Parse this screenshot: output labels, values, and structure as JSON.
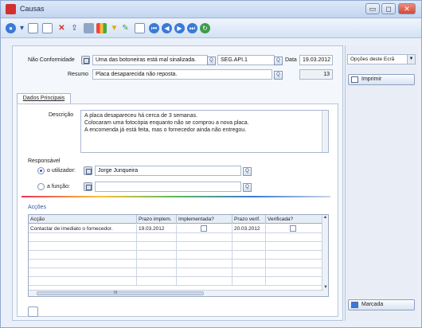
{
  "window": {
    "title": "Causas",
    "controls": {
      "minimize": "▭",
      "maximize": "◻",
      "close": "✕"
    }
  },
  "toolbar": {
    "icons": [
      "quick-access-icon",
      "new-icon",
      "copy-icon",
      "delete-icon",
      "export-icon",
      "list-icon",
      "chart-icon",
      "filter-icon",
      "edit-icon",
      "print-preview-icon",
      "nav-first-icon",
      "nav-prev-icon",
      "nav-next-icon",
      "nav-last-icon",
      "refresh-icon"
    ]
  },
  "form": {
    "nao_conformidade_label": "Não Conformidade",
    "nao_conformidade_value": "Uma das botoneiras está mal sinalizada.",
    "codigo_value": "SEG.API.1",
    "data_label": "Data",
    "data_value": "19.03.2012",
    "resumo_label": "Resumo",
    "resumo_value": "Placa desaparecida não reposta.",
    "resumo_number": "13"
  },
  "tabs": [
    {
      "label": "Dados Principais"
    }
  ],
  "descricao": {
    "label": "Descrição",
    "lines": [
      "A placa desapareceu há cerca de 3 semanas.",
      "Colocaram uma fotocópia enquanto não se comprou a nova placa.",
      "A encomenda já está feita, mas o fornecedor ainda não entregou."
    ]
  },
  "responsavel": {
    "label": "Responsável",
    "utilizador_label": "o utilizador:",
    "utilizador_value": "Jorge Junqueira",
    "funcao_label": "a função:",
    "funcao_value": ""
  },
  "accoes": {
    "label": "Acções",
    "columns": [
      "Acção",
      "Prazo implem.",
      "Implementada?",
      "Prazo verif.",
      "Verificada?"
    ],
    "rows": [
      {
        "accao": "Contactar de imediato o fornecedor.",
        "prazo_implem": "19.03.2012",
        "implementada": false,
        "prazo_verif": "20.03.2012",
        "verificada": false
      }
    ],
    "scroll_up": "▲",
    "scroll_down": "▼",
    "hthumb_grip": "III"
  },
  "side": {
    "select_value": "Opções deste Ecrã",
    "imprimir_label": "Imprimir",
    "marcada_label": "Marcada"
  },
  "colors": {
    "accent": "#2a58a8",
    "title_icon": "#d42f2f"
  }
}
